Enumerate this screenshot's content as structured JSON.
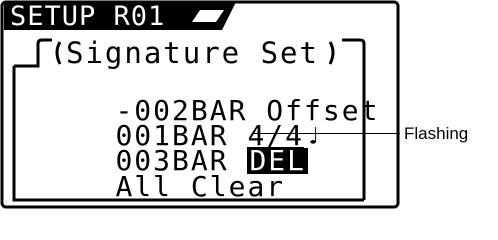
{
  "screen": {
    "header": "SETUP R01",
    "title": "Signature Set",
    "menu": {
      "offset": "-002BAR Offset",
      "signature_bar": "001BAR ",
      "signature_value": "4/4",
      "signature_note": "♩",
      "delete_bar": "003BAR ",
      "delete_value": "DEL",
      "clear": "All Clear"
    }
  },
  "annotation": {
    "label": "Flashing"
  },
  "icons": {
    "note": "quarter-note-icon"
  }
}
